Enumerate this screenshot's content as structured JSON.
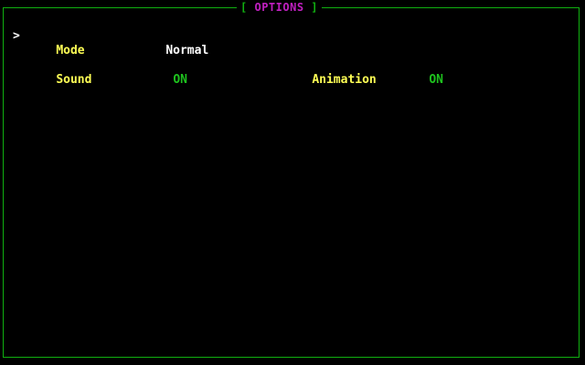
{
  "window": {
    "title_open": "[",
    "title": "OPTIONS",
    "title_close": "]"
  },
  "selection": {
    "cursor": ">"
  },
  "options": {
    "mode": {
      "label": "Mode",
      "value": "Normal"
    },
    "sound": {
      "label": "Sound",
      "value": "ON"
    },
    "animation": {
      "label": "Animation",
      "value": "ON"
    }
  },
  "colors": {
    "background": "#000000",
    "border": "#10b010",
    "title": "#c020c0",
    "label": "#ffff55",
    "value_selected": "#ffffff",
    "value_on": "#1ec21e"
  }
}
